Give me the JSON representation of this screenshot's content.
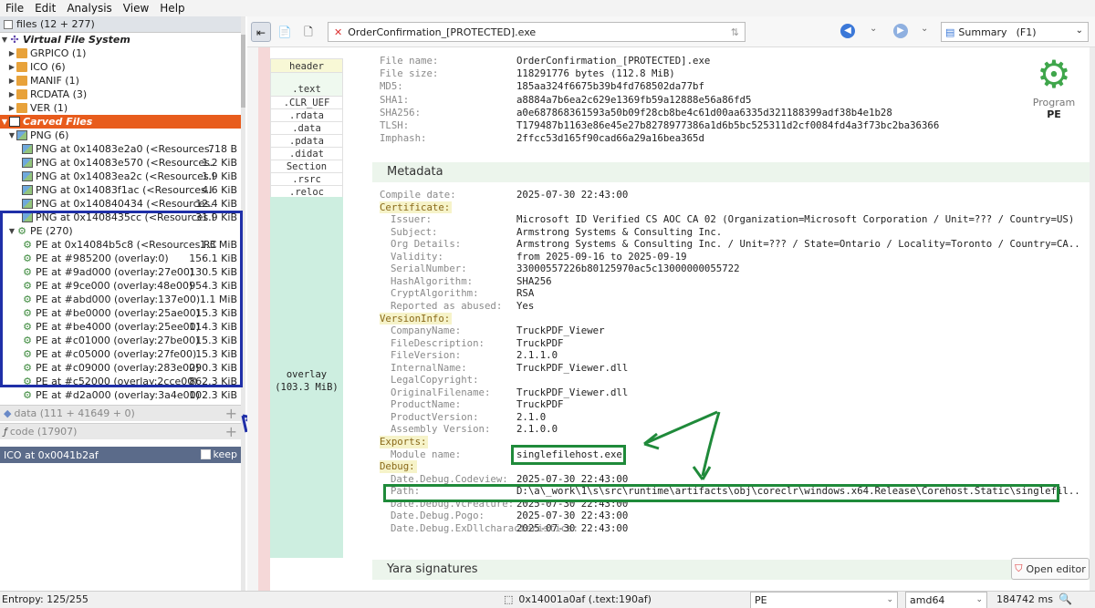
{
  "menu": [
    "File",
    "Edit",
    "Analysis",
    "View",
    "Help"
  ],
  "tree": {
    "header": "files (12 + 277)",
    "vfs_label": "Virtual File System",
    "vfs_items": [
      {
        "label": "GRPICO (1)"
      },
      {
        "label": "ICO (6)"
      },
      {
        "label": "MANIF (1)"
      },
      {
        "label": "RCDATA (3)"
      },
      {
        "label": "VER (1)"
      }
    ],
    "carved_label": "Carved Files",
    "png_group": "PNG (6)",
    "png_items": [
      {
        "label": "PNG at 0x14083e2a0 (<Resources.",
        "size": "718 B"
      },
      {
        "label": "PNG at 0x14083e570 (<Resources.",
        "size": "1.2 KiB"
      },
      {
        "label": "PNG at 0x14083ea2c (<Resources.I",
        "size": "1.9 KiB"
      },
      {
        "label": "PNG at 0x14083f1ac (<Resources.I",
        "size": "4.6 KiB"
      },
      {
        "label": "PNG at 0x140840434 (<Resources.",
        "size": "12.4 KiB"
      },
      {
        "label": "PNG at 0x1408435cc (<Resources.I",
        "size": "31.9 KiB"
      }
    ],
    "pe_group": "PE (270)",
    "pe_items": [
      {
        "label": "PE at 0x14084b5c8 (<Resources.RC",
        "size": "1.3 MiB"
      },
      {
        "label": "PE at #985200 (overlay:0)",
        "size": "156.1 KiB"
      },
      {
        "label": "PE at #9ad000 (overlay:27e00)",
        "size": "130.5 KiB"
      },
      {
        "label": "PE at #9ce000 (overlay:48e00)",
        "size": "954.3 KiB"
      },
      {
        "label": "PE at #abd000 (overlay:137e00)",
        "size": "1.1 MiB"
      },
      {
        "label": "PE at #be0000 (overlay:25ae00)",
        "size": "15.3 KiB"
      },
      {
        "label": "PE at #be4000 (overlay:25ee00)",
        "size": "114.3 KiB"
      },
      {
        "label": "PE at #c01000 (overlay:27be00)",
        "size": "15.3 KiB"
      },
      {
        "label": "PE at #c05000 (overlay:27fe00)",
        "size": "15.3 KiB"
      },
      {
        "label": "PE at #c09000 (overlay:283e00)",
        "size": "290.3 KiB"
      },
      {
        "label": "PE at #c52000 (overlay:2cce00)",
        "size": "862.3 KiB"
      },
      {
        "label": "PE at #d2a000 (overlay:3a4e00)",
        "size": "102.3 KiB"
      }
    ],
    "data_row": "data (111 + 41649 + 0)",
    "code_row": "code (17907)",
    "selected": "ICO at 0x0041b2af",
    "keep_label": "keep"
  },
  "toolbar": {
    "filename": "OrderConfirmation_[PROTECTED].exe",
    "view_select": "Summary",
    "view_shortcut": "(F1)"
  },
  "sections": {
    "header": "header",
    "list": [
      ".text",
      ".CLR_UEF",
      ".rdata",
      ".data",
      ".pdata",
      ".didat",
      "Section",
      ".rsrc",
      ".reloc"
    ],
    "overlay": "overlay",
    "overlay_size": "(103.3 MiB)"
  },
  "summary": {
    "program_label": "Program",
    "program_type": "PE",
    "fileinfo": [
      {
        "k": "File name:",
        "v": "OrderConfirmation_[PROTECTED].exe"
      },
      {
        "k": "File size:",
        "v": "118291776 bytes (112.8 MiB)"
      },
      {
        "k": "MD5:",
        "v": "185aa324f6675b39b4fd768502da77bf"
      },
      {
        "k": "SHA1:",
        "v": "a8884a7b6ea2c629e1369fb59a12888e56a86fd5"
      },
      {
        "k": "SHA256:",
        "v": "a0e687868361593a50b09f28cb8be4c61d00aa6335d321188399adf38b4e1b28"
      },
      {
        "k": "TLSH:",
        "v": "T179487b1163e86e45e27b8278977386a1d6b5bc525311d2cf0084fd4a3f73bc2ba36366"
      },
      {
        "k": "Imphash:",
        "v": "2ffcc53d165f90cad66a29a16bea365d"
      }
    ],
    "metadata_title": "Metadata",
    "compile": {
      "k": "Compile date:",
      "v": "2025-07-30 22:43:00"
    },
    "cert_label": "Certificate:",
    "cert": [
      {
        "k": "Issuer:",
        "v": "Microsoft ID Verified CS AOC CA 02 (Organization=Microsoft Corporation / Unit=??? / Country=US)"
      },
      {
        "k": "Subject:",
        "v": "Armstrong Systems & Consulting Inc."
      },
      {
        "k": "Org Details:",
        "v": "Armstrong Systems & Consulting Inc. / Unit=??? / State=Ontario / Locality=Toronto / Country=CA.."
      },
      {
        "k": "Validity:",
        "v": "from 2025-09-16 to 2025-09-19"
      },
      {
        "k": "SerialNumber:",
        "v": "33000557226b80125970ac5c13000000055722"
      },
      {
        "k": "HashAlgorithm:",
        "v": "SHA256"
      },
      {
        "k": "CryptAlgorithm:",
        "v": "RSA"
      },
      {
        "k": "Reported as abused:",
        "v": "Yes"
      }
    ],
    "version_label": "VersionInfo:",
    "version": [
      {
        "k": "CompanyName:",
        "v": "TruckPDF_Viewer"
      },
      {
        "k": "FileDescription:",
        "v": "TruckPDF"
      },
      {
        "k": "FileVersion:",
        "v": "2.1.1.0"
      },
      {
        "k": "InternalName:",
        "v": "TruckPDF_Viewer.dll"
      },
      {
        "k": "LegalCopyright:",
        "v": ""
      },
      {
        "k": "OriginalFilename:",
        "v": "TruckPDF_Viewer.dll"
      },
      {
        "k": "ProductName:",
        "v": "TruckPDF"
      },
      {
        "k": "ProductVersion:",
        "v": "2.1.0"
      },
      {
        "k": "Assembly Version:",
        "v": "2.1.0.0"
      }
    ],
    "exports_label": "Exports:",
    "exports": [
      {
        "k": "Module name:",
        "v": "singlefilehost.exe"
      }
    ],
    "debug_label": "Debug:",
    "debug": [
      {
        "k": "Date.Debug.Codeview:",
        "v": "2025-07-30 22:43:00"
      },
      {
        "k": "Path:",
        "v": "D:\\a\\_work\\1\\s\\src\\runtime\\artifacts\\obj\\coreclr\\windows.x64.Release\\Corehost.Static\\singlefil.."
      },
      {
        "k": "Date.Debug.VcFeature:",
        "v": "2025-07-30 22:43:00"
      },
      {
        "k": "Date.Debug.Pogo:",
        "v": "2025-07-30 22:43:00"
      },
      {
        "k": "Date.Debug.ExDllcharacteristics:",
        "v": "2025-07-30 22:43:00"
      }
    ],
    "yara_title": "Yara signatures",
    "open_editor": "Open editor"
  },
  "status": {
    "entropy": "Entropy: 125/255",
    "address": "0x14001a0af (.text:190af)",
    "format": "PE",
    "arch": "amd64",
    "time": "184742 ms"
  },
  "colors": {
    "carved_header": "#e85c1c",
    "annotation_blue": "#1f2fa8",
    "annotation_green": "#1f8a3a"
  }
}
